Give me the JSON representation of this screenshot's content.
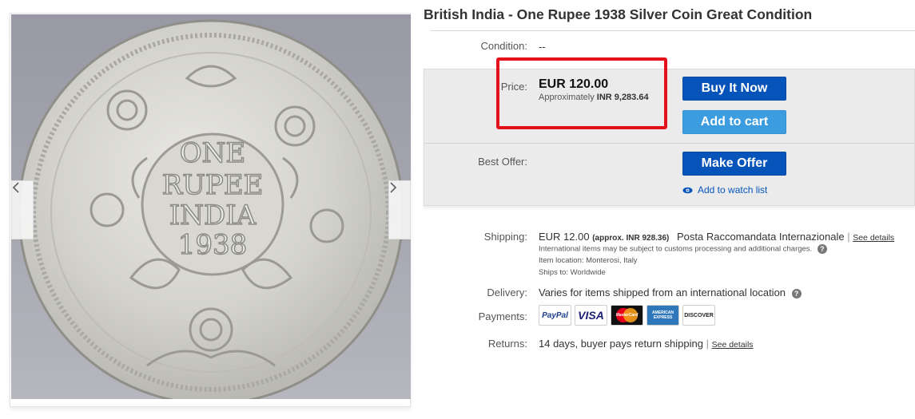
{
  "listing": {
    "title": "British India - One Rupee 1938 Silver Coin Great Condition",
    "image_alt_text": "ONE RUPEE INDIA 1938"
  },
  "condition": {
    "label": "Condition:",
    "value": "--"
  },
  "price": {
    "label": "Price:",
    "amount": "EUR 120.00",
    "approx_prefix": "Approximately",
    "approx_value": "INR 9,283.64"
  },
  "buttons": {
    "buy_now": "Buy It Now",
    "add_to_cart": "Add to cart",
    "make_offer": "Make Offer",
    "watch": "Add to watch list"
  },
  "best_offer": {
    "label": "Best Offer:"
  },
  "shipping": {
    "label": "Shipping:",
    "amount": "EUR 12.00",
    "approx": "(approx. INR 928.36)",
    "service": "Posta Raccomandata Internazionale",
    "separator": "|",
    "see_details": "See details",
    "note": "International items may be subject to customs processing and additional charges.",
    "location_label": "Item location:",
    "location": "Monterosi, Italy",
    "ships_to_label": "Ships to:",
    "ships_to": "Worldwide"
  },
  "delivery": {
    "label": "Delivery:",
    "value": "Varies for items shipped from an international location"
  },
  "payments": {
    "label": "Payments:",
    "methods": [
      "PayPal",
      "VISA",
      "MasterCard",
      "AMERICAN EXPRESS",
      "DISCOVER"
    ]
  },
  "returns": {
    "label": "Returns:",
    "value": "14 days, buyer pays return shipping",
    "separator": "|",
    "see_details": "See details"
  },
  "icons": {
    "prev": "chevron-left-icon",
    "next": "chevron-right-icon",
    "watch": "eye-icon",
    "help": "question-circle-icon"
  },
  "colors": {
    "primary_button": "#0654ba",
    "secondary_button": "#3b9de0",
    "highlight_box": "#e4111b",
    "buy_box_bg": "#ebebeb"
  }
}
